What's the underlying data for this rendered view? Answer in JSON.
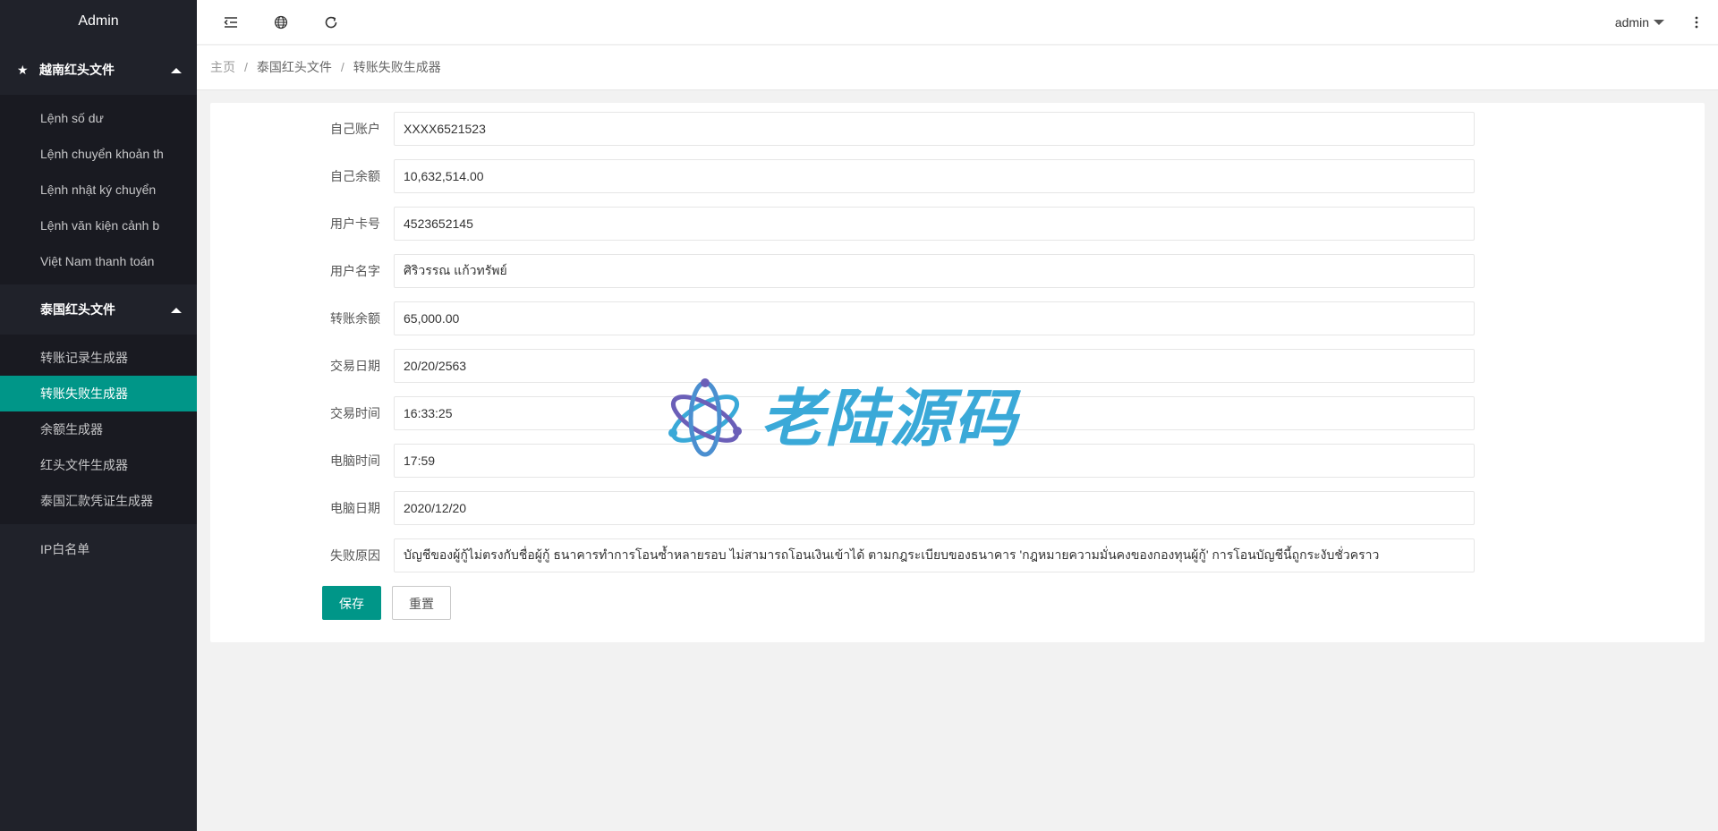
{
  "app": {
    "title": "Admin"
  },
  "sidebar": {
    "group1": {
      "label": "越南红头文件",
      "items": [
        {
          "label": "Lệnh số dư"
        },
        {
          "label": "Lệnh chuyển khoản th"
        },
        {
          "label": "Lệnh nhật ký chuyển"
        },
        {
          "label": "Lệnh văn kiện cảnh b"
        },
        {
          "label": "Việt Nam thanh toán"
        }
      ]
    },
    "group2": {
      "label": "泰国红头文件",
      "items": [
        {
          "label": "转账记录生成器"
        },
        {
          "label": "转账失败生成器"
        },
        {
          "label": "余额生成器"
        },
        {
          "label": "红头文件生成器"
        },
        {
          "label": "泰国汇款凭证生成器"
        }
      ]
    },
    "ip_whitelist": "IP白名单"
  },
  "header": {
    "icons": [
      "menu-fold-icon",
      "globe-icon",
      "refresh-icon"
    ],
    "user": "admin",
    "more_icon": "more-vertical-icon"
  },
  "breadcrumb": {
    "home": "主页",
    "parent": "泰国红头文件",
    "current": "转账失败生成器",
    "separator": "/"
  },
  "form": {
    "fields": [
      {
        "label": "自己账户",
        "value": "XXXX6521523"
      },
      {
        "label": "自己余额",
        "value": "10,632,514.00"
      },
      {
        "label": "用户卡号",
        "value": "4523652145"
      },
      {
        "label": "用户名字",
        "value": "ศิริวรรณ แก้วทรัพย์"
      },
      {
        "label": "转账余额",
        "value": "65,000.00"
      },
      {
        "label": "交易日期",
        "value": "20/20/2563"
      },
      {
        "label": "交易时间",
        "value": "16:33:25"
      },
      {
        "label": "电脑时间",
        "value": "17:59"
      },
      {
        "label": "电脑日期",
        "value": "2020/12/20"
      },
      {
        "label": "失败原因",
        "value": "บัญชีของผู้กู้ไม่ตรงกับชื่อผู้กู้ ธนาคารทำการโอนซ้ำหลายรอบ ไม่สามารถโอนเงินเข้าได้ ตามกฎระเบียบของธนาคาร 'กฎหมายความมั่นคงของกองทุนผู้กู้' การโอนบัญชีนี้ถูกระงับชั่วคราว"
      }
    ],
    "save_label": "保存",
    "reset_label": "重置"
  },
  "watermark": {
    "text": "老陆源码"
  },
  "colors": {
    "sidebar_bg": "#20222a",
    "sidebar_sub_bg": "#191a21",
    "accent": "#009688",
    "watermark": "#3aa9d8"
  }
}
